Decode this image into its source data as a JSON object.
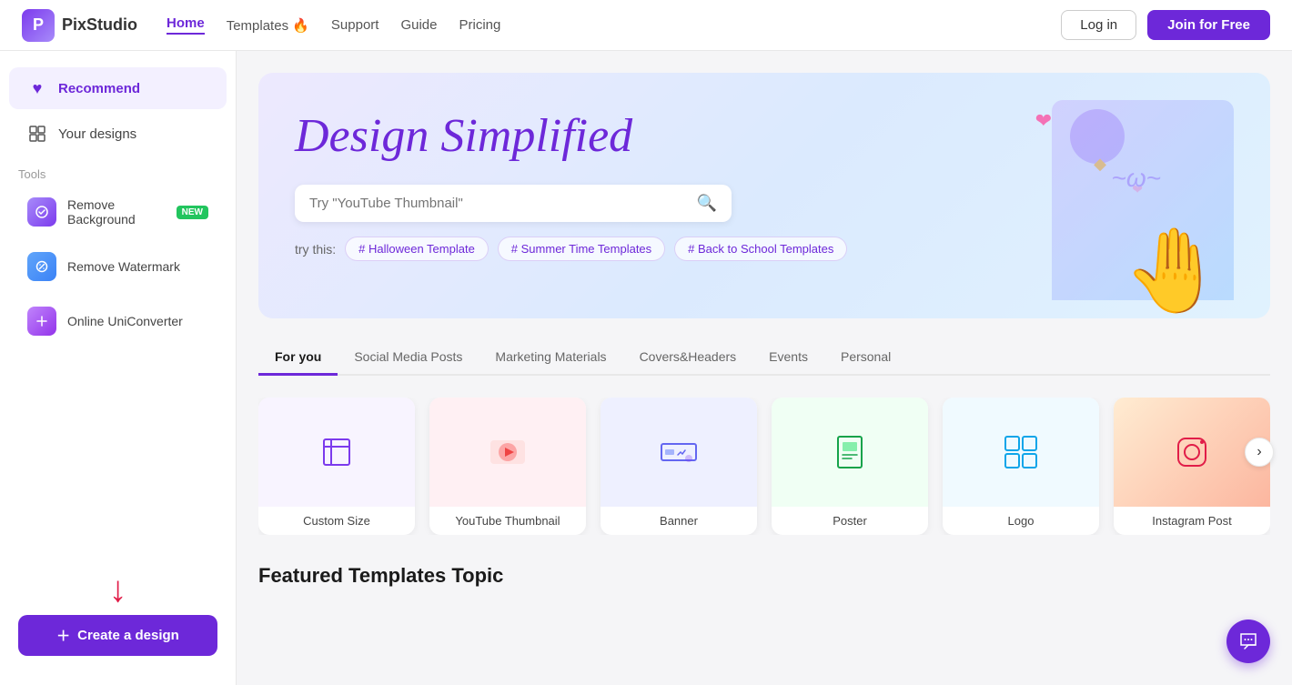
{
  "nav": {
    "logo_text": "PixStudio",
    "links": [
      {
        "id": "home",
        "label": "Home",
        "active": true
      },
      {
        "id": "templates",
        "label": "Templates 🔥",
        "active": false
      },
      {
        "id": "support",
        "label": "Support",
        "active": false
      },
      {
        "id": "guide",
        "label": "Guide",
        "active": false
      },
      {
        "id": "pricing",
        "label": "Pricing",
        "active": false
      }
    ],
    "login_label": "Log in",
    "join_label": "Join for Free"
  },
  "sidebar": {
    "recommend_label": "Recommend",
    "your_designs_label": "Your designs",
    "tools_label": "Tools",
    "tools": [
      {
        "id": "remove-bg",
        "label": "Remove Background",
        "badge": "NEW"
      },
      {
        "id": "remove-watermark",
        "label": "Remove Watermark",
        "badge": ""
      },
      {
        "id": "uniconverter",
        "label": "Online UniConverter",
        "badge": ""
      }
    ],
    "create_label": "Create a design"
  },
  "hero": {
    "title": "Design Simplified",
    "search_placeholder": "Try \"YouTube Thumbnail\"",
    "try_this_label": "try this:",
    "tags": [
      {
        "id": "halloween",
        "label": "# Halloween Template"
      },
      {
        "id": "summer",
        "label": "# Summer Time Templates"
      },
      {
        "id": "school",
        "label": "# Back to School Templates"
      }
    ]
  },
  "tabs": [
    {
      "id": "for-you",
      "label": "For you",
      "active": true
    },
    {
      "id": "social-media",
      "label": "Social Media Posts",
      "active": false
    },
    {
      "id": "marketing",
      "label": "Marketing Materials",
      "active": false
    },
    {
      "id": "covers",
      "label": "Covers&Headers",
      "active": false
    },
    {
      "id": "events",
      "label": "Events",
      "active": false
    },
    {
      "id": "personal",
      "label": "Personal",
      "active": false
    }
  ],
  "templates": [
    {
      "id": "custom-size",
      "label": "Custom Size",
      "icon": "⊡",
      "bg": "custom"
    },
    {
      "id": "youtube-thumbnail",
      "label": "YouTube Thumbnail",
      "icon": "▶",
      "bg": "youtube"
    },
    {
      "id": "banner",
      "label": "Banner",
      "icon": "📊",
      "bg": "banner"
    },
    {
      "id": "poster",
      "label": "Poster",
      "icon": "🖼",
      "bg": "poster"
    },
    {
      "id": "logo",
      "label": "Logo",
      "icon": "⬡",
      "bg": "logo"
    },
    {
      "id": "instagram-post",
      "label": "Instagram Post",
      "icon": "📷",
      "bg": "instagram"
    }
  ],
  "featured_section_title": "Featured Templates Topic"
}
